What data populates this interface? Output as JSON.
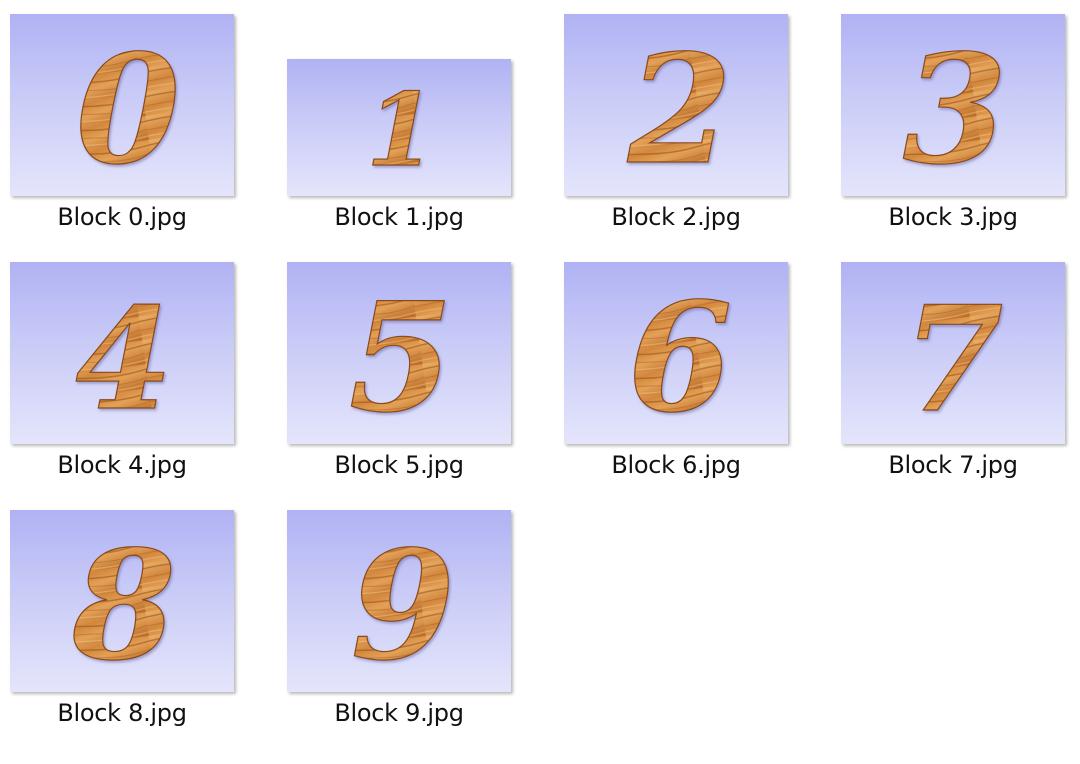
{
  "files": [
    {
      "name": "Block 0.jpg",
      "digit": "0"
    },
    {
      "name": "Block 1.jpg",
      "digit": "1"
    },
    {
      "name": "Block 2.jpg",
      "digit": "2"
    },
    {
      "name": "Block 3.jpg",
      "digit": "3"
    },
    {
      "name": "Block 4.jpg",
      "digit": "4"
    },
    {
      "name": "Block 5.jpg",
      "digit": "5"
    },
    {
      "name": "Block 6.jpg",
      "digit": "6"
    },
    {
      "name": "Block 7.jpg",
      "digit": "7"
    },
    {
      "name": "Block 8.jpg",
      "digit": "8"
    },
    {
      "name": "Block 9.jpg",
      "digit": "9"
    }
  ],
  "colors": {
    "thumb_top": "#b0b2f4",
    "thumb_bottom": "#e4e5fb",
    "wood_light": "#e6a35a",
    "wood_mid": "#c9782f",
    "wood_dark": "#8a4a17"
  }
}
